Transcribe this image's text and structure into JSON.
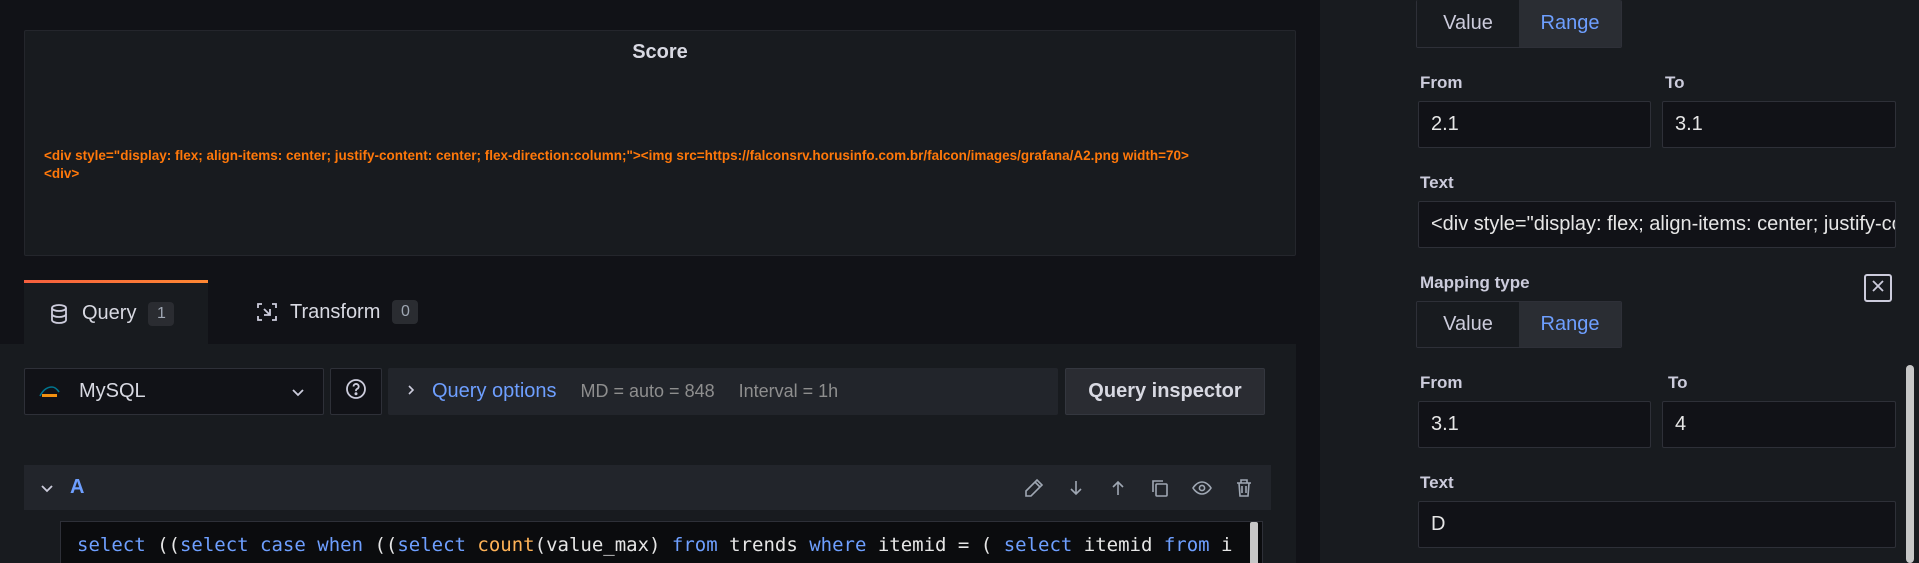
{
  "panel": {
    "title": "Score",
    "content_line1": "<div style=\"display: flex; align-items: center; justify-content: center; flex-direction:column;\"><img src=https://falconsrv.horusinfo.com.br/falcon/images/grafana/A2.png width=70>",
    "content_line2": "<div>"
  },
  "tabs": [
    {
      "label": "Query",
      "count": "1",
      "icon": "database-icon"
    },
    {
      "label": "Transform",
      "count": "0",
      "icon": "transform-icon"
    }
  ],
  "datasource": {
    "name": "MySQL",
    "icon": "mysql-logo"
  },
  "query_options": {
    "title": "Query options",
    "md": "MD = auto = 848",
    "interval": "Interval = 1h"
  },
  "query_inspector": {
    "label": "Query inspector"
  },
  "query_row": {
    "letter": "A"
  },
  "sql": {
    "tokens": [
      [
        "kw",
        "select "
      ],
      [
        "op",
        "(("
      ],
      [
        "kw",
        "select "
      ],
      [
        "kw",
        "case "
      ],
      [
        "kw",
        "when "
      ],
      [
        "op",
        "(("
      ],
      [
        "kw",
        "select "
      ],
      [
        "fn",
        "count"
      ],
      [
        "op",
        "("
      ],
      [
        "idn",
        "value_max"
      ],
      [
        "op",
        ") "
      ],
      [
        "kw",
        "from "
      ],
      [
        "idn",
        "trends "
      ],
      [
        "kw",
        "where "
      ],
      [
        "idn",
        "itemid "
      ],
      [
        "op",
        "= ( "
      ],
      [
        "kw",
        "select "
      ],
      [
        "idn",
        "itemid "
      ],
      [
        "kw",
        "from "
      ],
      [
        "idn",
        "i"
      ]
    ]
  },
  "mappings": {
    "seg_value": "Value",
    "seg_range": "Range",
    "from_label": "From",
    "to_label": "To",
    "text_label": "Text",
    "mapping_type_label": "Mapping type",
    "m1": {
      "from": "2.1",
      "to": "3.1",
      "text": "<div style=\"display: flex; align-items: center; justify-content: center; flex-direction:column;\">"
    },
    "m2": {
      "from": "3.1",
      "to": "4",
      "text": "D"
    }
  },
  "colors": {
    "accent": "#6e9fff",
    "warning_text": "#ff780a",
    "active_tab_gradient_start": "#f55f3e",
    "active_tab_gradient_end": "#ff8833"
  }
}
